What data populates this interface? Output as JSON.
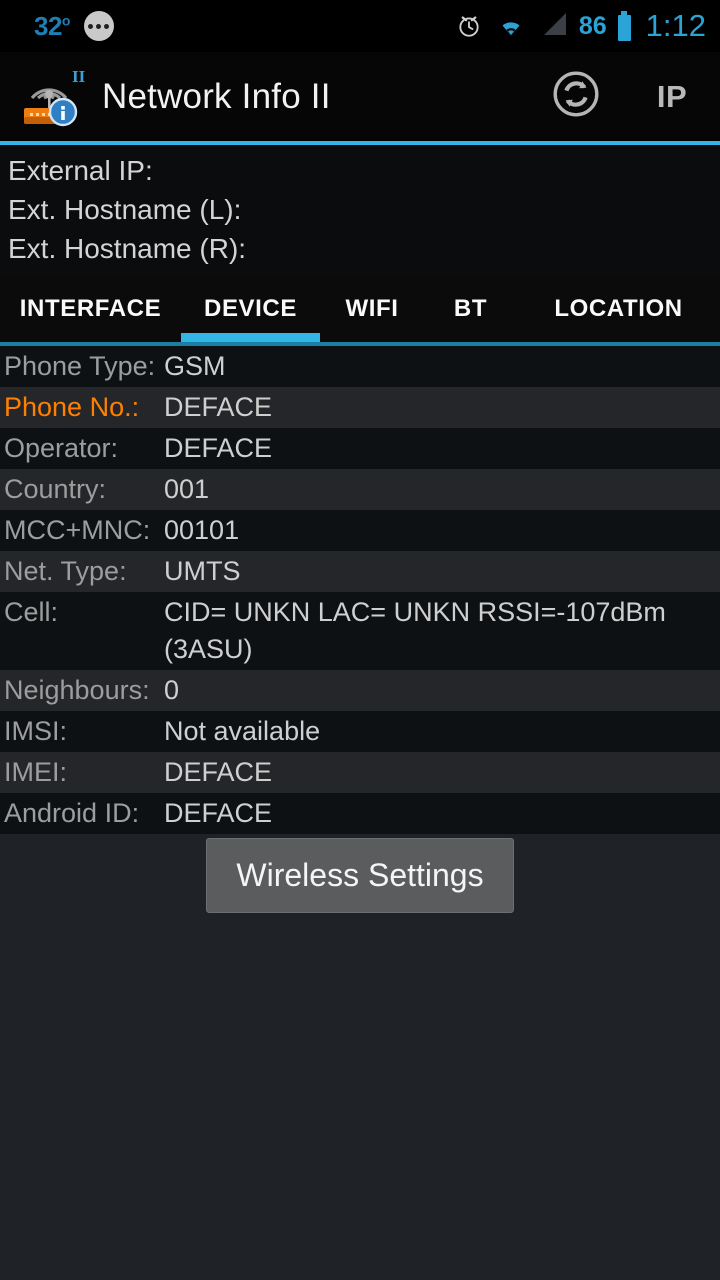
{
  "statusbar": {
    "temperature": "32",
    "temperature_unit": "o",
    "notification_icon": "more-dots-icon",
    "alarm_icon": "alarm-clock-icon",
    "wifi_icon": "wifi-signal-icon",
    "cell_icon": "cell-signal-icon",
    "battery_percent": "86",
    "battery_icon": "battery-icon",
    "clock": "1:12",
    "accent_color": "#2aa3d6"
  },
  "actionbar": {
    "app_icon": "network-info-app-icon",
    "title": "Network Info II",
    "refresh_icon": "refresh-sync-icon",
    "ip_label": "IP",
    "accent_color": "#33b5e5"
  },
  "external": {
    "lines": [
      "External IP:",
      "Ext. Hostname (L):",
      "Ext. Hostname (R):"
    ]
  },
  "tabs": {
    "items": [
      {
        "label": "INTERFACE",
        "selected": false
      },
      {
        "label": "DEVICE",
        "selected": true
      },
      {
        "label": "WIFI",
        "selected": false
      },
      {
        "label": "BT",
        "selected": false
      },
      {
        "label": "LOCATION",
        "selected": false
      }
    ],
    "indicator_color": "#33b5e5"
  },
  "device": {
    "rows": [
      {
        "label": "Phone Type:",
        "value": "GSM",
        "highlight": false
      },
      {
        "label": "Phone No.:",
        "value": "DEFACE",
        "highlight": true
      },
      {
        "label": "Operator:",
        "value": "DEFACE",
        "highlight": false
      },
      {
        "label": "Country:",
        "value": "001",
        "highlight": false
      },
      {
        "label": "MCC+MNC:",
        "value": "00101",
        "highlight": false
      },
      {
        "label": "Net. Type:",
        "value": "UMTS",
        "highlight": false
      },
      {
        "label": "Cell:",
        "value": "CID= UNKN LAC= UNKN RSSI=-107dBm (3ASU)",
        "highlight": false
      },
      {
        "label": "Neighbours:",
        "value": "0",
        "highlight": false
      },
      {
        "label": "IMSI:",
        "value": "Not available",
        "highlight": false
      },
      {
        "label": "IMEI:",
        "value": "DEFACE",
        "highlight": false
      },
      {
        "label": "Android ID:",
        "value": "DEFACE",
        "highlight": false
      }
    ],
    "highlight_color": "#ff8000"
  },
  "actions": {
    "wireless_settings_label": "Wireless Settings"
  }
}
